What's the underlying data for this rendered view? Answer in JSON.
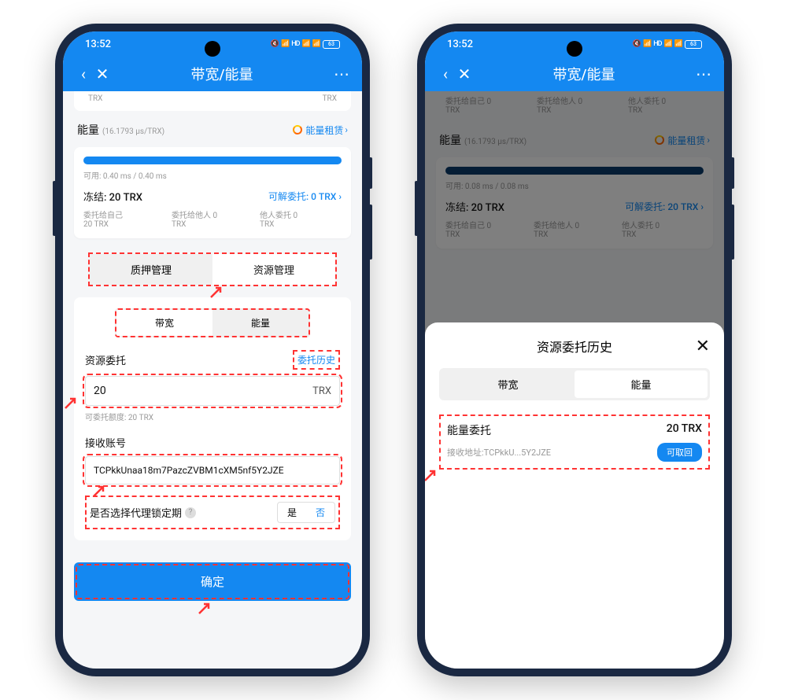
{
  "time": "13:52",
  "battery": "63",
  "header": {
    "title": "带宽/能量"
  },
  "p1": {
    "trx": "TRX",
    "energy": {
      "title": "能量",
      "sub": "(16.1793 µs/TRX)",
      "link": "能量租赁"
    },
    "progress": "可用: 0.40 ms / 0.40 ms",
    "frozen": "冻结: 20 TRX",
    "unstake": "可解委托: 0 TRX",
    "dg": [
      {
        "l": "委托给自己",
        "v": "20 TRX"
      },
      {
        "l": "委托给他人 0",
        "v": "TRX"
      },
      {
        "l": "他人委托 0",
        "v": "TRX"
      }
    ],
    "tabs": [
      "质押管理",
      "资源管理"
    ],
    "miniTabs": [
      "带宽",
      "能量"
    ],
    "form": {
      "label": "资源委托",
      "link": "委托历史",
      "value": "20",
      "suffix": "TRX",
      "hint": "可委托额度: 20 TRX",
      "acctLabel": "接收账号",
      "acct": "TCPkkUnaa18m7PazcZVBM1cXM5nf5Y2JZE",
      "lockLabel": "是否选择代理锁定期",
      "yes": "是",
      "no": "否"
    },
    "confirm": "确定"
  },
  "p2": {
    "bgDg": [
      {
        "l": "委托给自己 0",
        "v": "TRX"
      },
      {
        "l": "委托给他人 0",
        "v": "TRX"
      },
      {
        "l": "他人委托 0",
        "v": "TRX"
      }
    ],
    "energy": {
      "title": "能量",
      "sub": "(16.1793 µs/TRX)",
      "link": "能量租赁"
    },
    "progress": "可用: 0.08 ms / 0.08 ms",
    "frozen": "冻结: 20 TRX",
    "unstake": "可解委托: 20 TRX",
    "dg": [
      {
        "l": "委托给自己 0",
        "v": "TRX"
      },
      {
        "l": "委托给他人 0",
        "v": "TRX"
      },
      {
        "l": "他人委托 0",
        "v": "TRX"
      }
    ],
    "sheet": {
      "title": "资源委托历史",
      "tabs": [
        "带宽",
        "能量"
      ],
      "item": {
        "name": "能量委托",
        "amt": "20 TRX",
        "addrLabel": "接收地址:",
        "addr": "TCPkkU...5Y2JZE",
        "btn": "可取回"
      }
    }
  }
}
